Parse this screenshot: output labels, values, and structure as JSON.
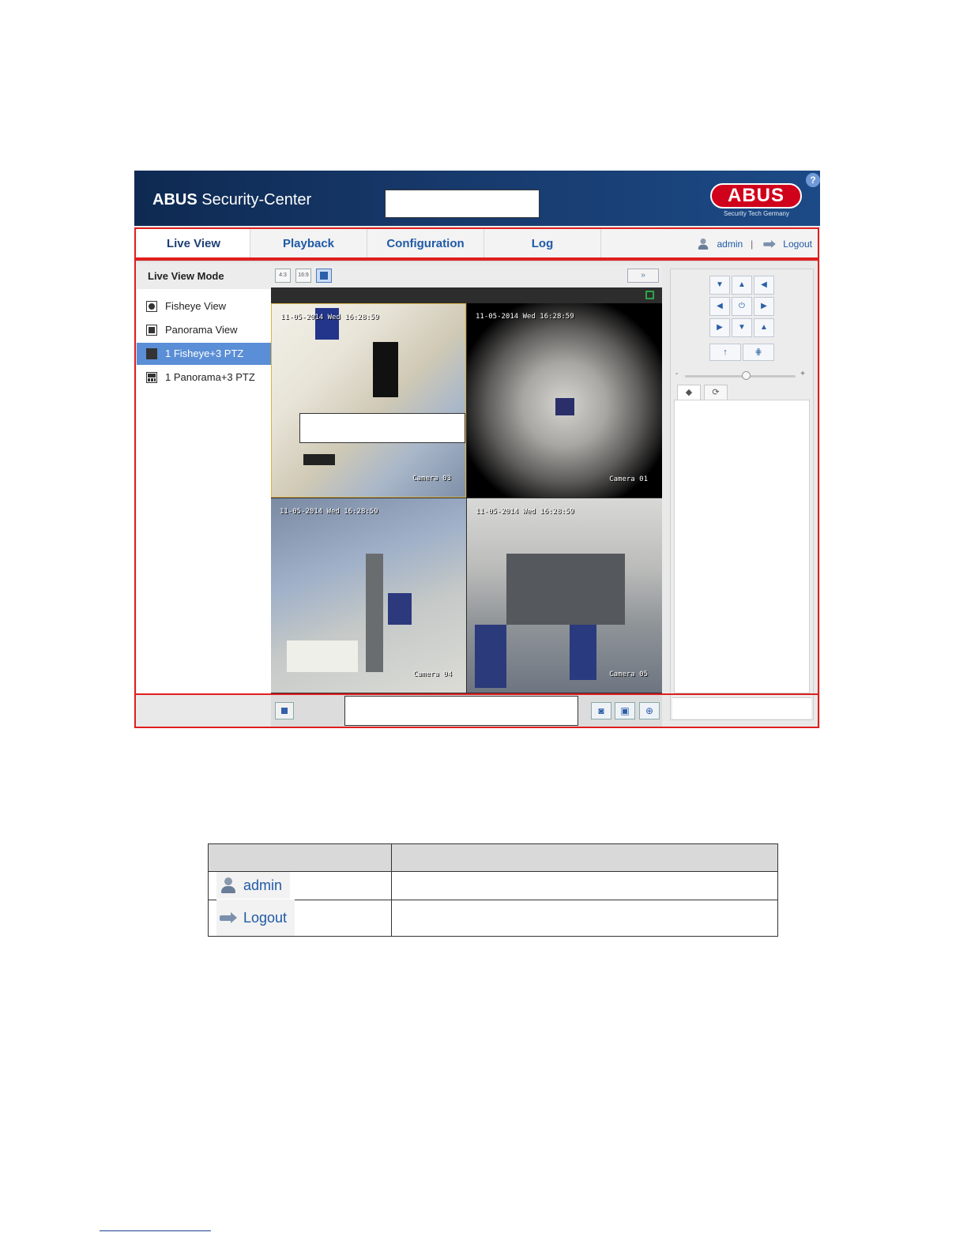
{
  "header": {
    "brand_bold": "ABUS",
    "brand_rest": " Security-Center",
    "logo_text": "ABUS",
    "logo_tagline": "Security Tech Germany",
    "help_icon": "?"
  },
  "nav": {
    "tabs": [
      {
        "label": "Live View",
        "active": true
      },
      {
        "label": "Playback",
        "active": false
      },
      {
        "label": "Configuration",
        "active": false
      },
      {
        "label": "Log",
        "active": false
      }
    ],
    "user_label": "admin",
    "separator": "|",
    "logout_label": "Logout"
  },
  "left_panel": {
    "title": "Live View Mode",
    "modes": [
      {
        "label": "Fisheye View",
        "icon": "fisheye-icon",
        "selected": false
      },
      {
        "label": "Panorama View",
        "icon": "panorama-icon",
        "selected": false
      },
      {
        "label": "1 Fisheye+3 PTZ",
        "icon": "grid-4-icon",
        "selected": true
      },
      {
        "label": "1 Panorama+3 PTZ",
        "icon": "grid-4-panorama-icon",
        "selected": false
      }
    ]
  },
  "video_toolbar": {
    "ratio_a": "4:3",
    "ratio_b": "16:9",
    "right_button": "»"
  },
  "video_tiles": [
    {
      "timestamp": "11-05-2014 Wed 16:28:59",
      "camera": "Camera 03"
    },
    {
      "timestamp": "11-05-2014 Wed 16:28:59",
      "camera": "Camera 01"
    },
    {
      "timestamp": "11-05-2014 Wed 16:28:59",
      "camera": "Camera 04"
    },
    {
      "timestamp": "11-05-2014 Wed 16:28:59",
      "camera": "Camera 05"
    }
  ],
  "bottom_toolbar": {
    "snapshot_icon": "camera-icon",
    "record_icon": "record-icon",
    "zoom_icon": "zoom-icon"
  },
  "ptz": {
    "arrows": [
      "▼",
      "▲",
      "◀",
      "◀",
      "⏻",
      "▶",
      "▶",
      "▼",
      "▲"
    ],
    "focus_near": "↑",
    "focus_far": "⋕",
    "slider_minus": "-",
    "slider_plus": "+",
    "tab_preset_icon": "preset-icon",
    "tab_patrol_icon": "patrol-icon",
    "speed_level": 0.55
  },
  "legend_table": {
    "rows": [
      {
        "label": "admin",
        "icon": "user-icon"
      },
      {
        "label": "Logout",
        "icon": "logout-icon"
      }
    ]
  }
}
